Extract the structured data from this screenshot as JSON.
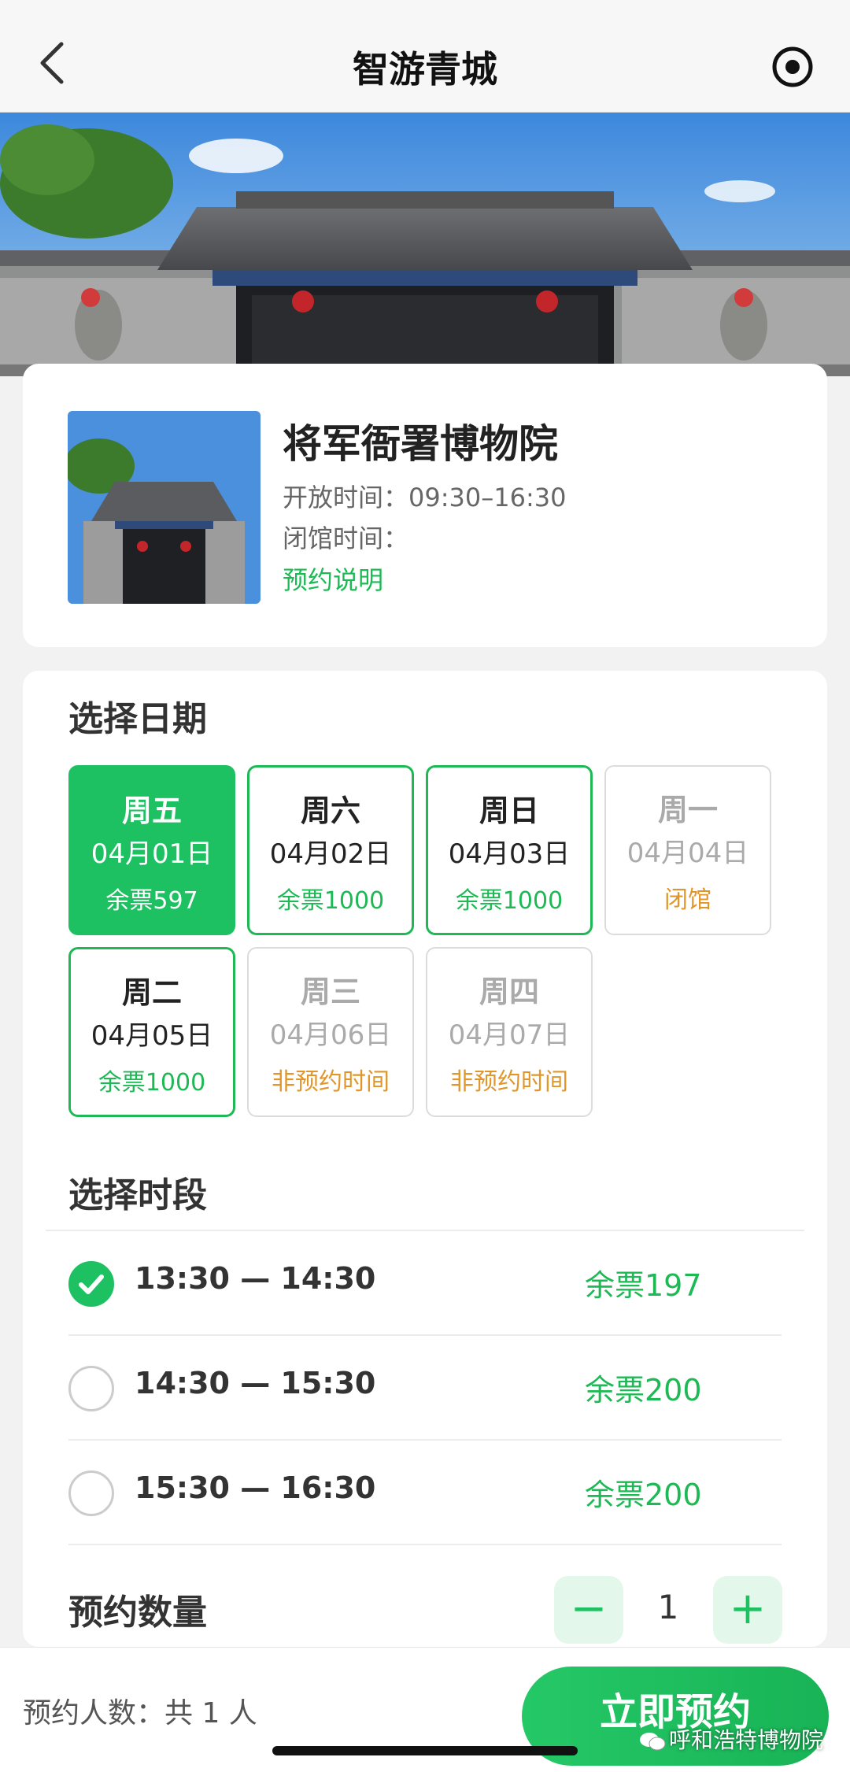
{
  "navbar": {
    "title": "智游青城"
  },
  "museum": {
    "name": "将军衙署博物院",
    "open_time": "开放时间：09:30–16:30",
    "close_time": "闭馆时间：",
    "booking_note": "预约说明"
  },
  "date_section": {
    "title": "选择日期",
    "dates": [
      {
        "weekday": "周五",
        "date": "04月01日",
        "status": "余票597",
        "state": "selected"
      },
      {
        "weekday": "周六",
        "date": "04月02日",
        "status": "余票1000",
        "state": "available"
      },
      {
        "weekday": "周日",
        "date": "04月03日",
        "status": "余票1000",
        "state": "available"
      },
      {
        "weekday": "周一",
        "date": "04月04日",
        "status": "闭馆",
        "state": "disabled"
      },
      {
        "weekday": "周二",
        "date": "04月05日",
        "status": "余票1000",
        "state": "available"
      },
      {
        "weekday": "周三",
        "date": "04月06日",
        "status": "非预约时间",
        "state": "disabled"
      },
      {
        "weekday": "周四",
        "date": "04月07日",
        "status": "非预约时间",
        "state": "disabled"
      }
    ]
  },
  "slot_section": {
    "title": "选择时段",
    "slots": [
      {
        "time": "13:30 — 14:30",
        "remaining": "余票197",
        "checked": true
      },
      {
        "time": "14:30 — 15:30",
        "remaining": "余票200",
        "checked": false
      },
      {
        "time": "15:30 — 16:30",
        "remaining": "余票200",
        "checked": false
      }
    ]
  },
  "quantity": {
    "label": "预约数量",
    "value": "1",
    "minus": "−",
    "plus": "+"
  },
  "bottom": {
    "people_count": "预约人数：共 1 人",
    "reserve_label": "立即预约",
    "watermark": "呼和浩特博物院"
  },
  "colors": {
    "accent": "#1ec162",
    "warning": "#e0962a"
  }
}
